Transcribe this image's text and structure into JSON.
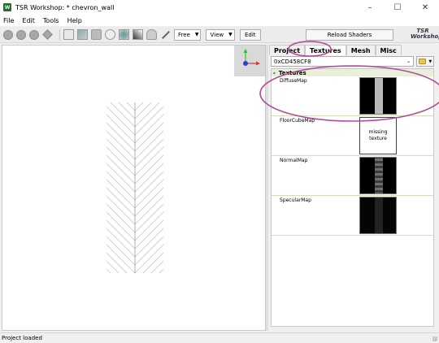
{
  "window": {
    "title": "TSR Workshop: * chevron_wall",
    "app_icon": "tsr-app-icon",
    "minimize_glyph": "–",
    "maximize_glyph": "☐",
    "close_glyph": "✕"
  },
  "menu": {
    "items": [
      "File",
      "Edit",
      "Tools",
      "Help"
    ]
  },
  "toolbar": {
    "camera_mode": "Free",
    "view_label": "View",
    "edit_label": "Edit",
    "reload_label": "Reload Shaders",
    "logo_text_top": "TSR",
    "logo_text_bottom": "Workshop"
  },
  "tabs": [
    "Project",
    "Textures",
    "Mesh",
    "Misc"
  ],
  "active_tab": "Textures",
  "texture_set": {
    "selected": "0xCD458CF8"
  },
  "textures": {
    "header": "Textures",
    "toggle": "-",
    "items": [
      {
        "label": "DiffuseMap",
        "kind": "diffuse"
      },
      {
        "label": "FloorCubeMap",
        "kind": "missing",
        "missing_text_1": "missing",
        "missing_text_2": "texture"
      },
      {
        "label": "NormalMap",
        "kind": "normal"
      },
      {
        "label": "SpecularMap",
        "kind": "specular"
      }
    ]
  },
  "status": {
    "text": "Project loaded"
  },
  "colors": {
    "annotation": "#b24a9a",
    "gizmo_x": "#e0342a",
    "gizmo_y": "#2fbf2f",
    "gizmo_z": "#2a3fd8"
  }
}
